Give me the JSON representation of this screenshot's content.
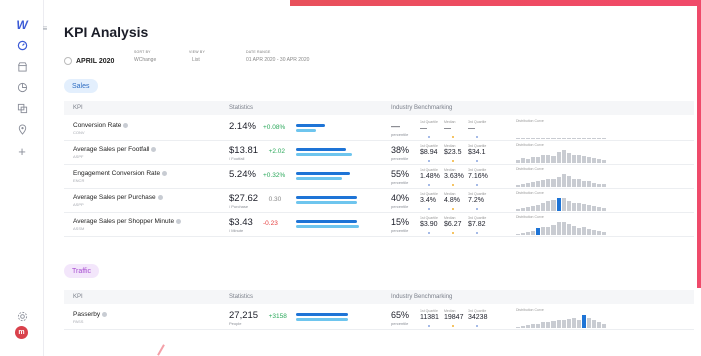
{
  "page": {
    "title": "KPI Analysis",
    "date_button": "APRIL 2020",
    "filters": [
      {
        "label": "SORT BY",
        "value": "WChange"
      },
      {
        "label": "VIEW BY",
        "value": "List"
      },
      {
        "label": "DATE RANGE",
        "value": "01 APR 2020 - 30 APR 2020"
      }
    ]
  },
  "colors": {
    "accent_blue": "#1e74d6",
    "light_blue": "#6ec5ee",
    "positive": "#2aa85a",
    "negative": "#e53e3e",
    "brand_pink": "#ef4a6a"
  },
  "icons": {
    "sidebar": [
      "logo-icon",
      "dashboard-icon",
      "store-icon",
      "chart-icon",
      "layers-icon",
      "location-icon",
      "add-icon"
    ],
    "settings": "settings-icon",
    "avatar": "m"
  },
  "table_headers": {
    "kpi": "KPI",
    "statistics": "Statistics",
    "benchmark": "Industry Benchmarking"
  },
  "sections": [
    {
      "label": "Sales",
      "rows": [
        {
          "name": "Conversion Rate",
          "code": "CONV",
          "value": "2.14%",
          "value_sub": "",
          "delta": "+0.08%",
          "delta_kind": "pos",
          "bar1": 0.45,
          "bar2": 0.32,
          "pct": "—",
          "pct_sub": "percentile",
          "q": [
            {
              "l": "1st Quartile",
              "v": "—"
            },
            {
              "l": "Median",
              "v": "—"
            },
            {
              "l": "3rd Quartile",
              "v": "—"
            }
          ],
          "dist_label": "Distribution Curve",
          "dist": [
            0.1,
            0.1,
            0.1,
            0.1,
            0.1,
            0.1,
            0.1,
            0.1,
            0.1,
            0.1,
            0.1,
            0.1,
            0.1,
            0.1,
            0.1,
            0.1,
            0.1,
            0.1
          ],
          "dist_hl": -1
        },
        {
          "name": "Average Sales per Footfall",
          "code": "ASPF",
          "value": "$13.81",
          "value_sub": "/ Footfall",
          "delta": "+2.02",
          "delta_kind": "pos",
          "bar1": 0.78,
          "bar2": 0.88,
          "pct": "38%",
          "pct_sub": "percentile",
          "q": [
            {
              "l": "1st Quartile",
              "v": "$8.94"
            },
            {
              "l": "Median",
              "v": "$23.5"
            },
            {
              "l": "3rd Quartile",
              "v": "$34.1"
            }
          ],
          "dist_label": "Distribution Curve",
          "dist": [
            0.2,
            0.35,
            0.3,
            0.45,
            0.4,
            0.55,
            0.6,
            0.5,
            0.8,
            0.9,
            0.7,
            0.55,
            0.6,
            0.5,
            0.45,
            0.35,
            0.3,
            0.25
          ],
          "dist_hl": -1
        },
        {
          "name": "Engagement Conversion Rate",
          "code": "ENCR",
          "value": "5.24%",
          "value_sub": "",
          "delta": "+0.32%",
          "delta_kind": "pos",
          "bar1": 0.85,
          "bar2": 0.72,
          "pct": "55%",
          "pct_sub": "percentile",
          "q": [
            {
              "l": "1st Quartile",
              "v": "1.48%"
            },
            {
              "l": "Median",
              "v": "3.63%"
            },
            {
              "l": "3rd Quartile",
              "v": "7.16%"
            }
          ],
          "dist_label": "Distribution Curve",
          "dist": [
            0.15,
            0.25,
            0.3,
            0.35,
            0.45,
            0.5,
            0.55,
            0.6,
            0.7,
            0.9,
            0.8,
            0.6,
            0.55,
            0.45,
            0.4,
            0.3,
            0.25,
            0.2
          ],
          "dist_hl": -1
        },
        {
          "name": "Average Sales per Purchase",
          "code": "ASPP",
          "value": "$27.62",
          "value_sub": "/ Purchase",
          "delta": "0.30",
          "delta_kind": "neu",
          "bar1": 0.95,
          "bar2": 0.95,
          "pct": "40%",
          "pct_sub": "percentile",
          "q": [
            {
              "l": "1st Quartile",
              "v": "3.4%"
            },
            {
              "l": "Median",
              "v": "4.8%"
            },
            {
              "l": "3rd Quartile",
              "v": "7.2%"
            }
          ],
          "dist_label": "Distribution Curve",
          "dist": [
            0.15,
            0.2,
            0.3,
            0.35,
            0.4,
            0.6,
            0.7,
            0.8,
            0.95,
            0.9,
            0.75,
            0.6,
            0.55,
            0.5,
            0.4,
            0.35,
            0.3,
            0.25
          ],
          "dist_hl": 8
        },
        {
          "name": "Average Sales per Shopper Minute",
          "code": "ASSM",
          "value": "$3.43",
          "value_sub": "/ Minute",
          "delta": "-0.23",
          "delta_kind": "neg",
          "bar1": 0.95,
          "bar2": 0.98,
          "pct": "15%",
          "pct_sub": "percentile",
          "q": [
            {
              "l": "1st Quartile",
              "v": "$3.90"
            },
            {
              "l": "Median",
              "v": "$6.27"
            },
            {
              "l": "3rd Quartile",
              "v": "$7.82"
            }
          ],
          "dist_label": "Distribution Curve",
          "dist": [
            0.1,
            0.15,
            0.2,
            0.3,
            0.5,
            0.6,
            0.55,
            0.7,
            0.9,
            0.95,
            0.8,
            0.65,
            0.5,
            0.55,
            0.45,
            0.35,
            0.3,
            0.2
          ],
          "dist_hl": 4
        }
      ]
    },
    {
      "label": "Traffic",
      "rows": [
        {
          "name": "Passerby",
          "code": "PASS",
          "value": "27,215",
          "value_sub": "People",
          "delta": "+3158",
          "delta_kind": "pos",
          "bar1": 0.82,
          "bar2": 0.82,
          "pct": "65%",
          "pct_sub": "percentile",
          "q": [
            {
              "l": "1st Quartile",
              "v": "11381"
            },
            {
              "l": "Median",
              "v": "19847"
            },
            {
              "l": "3rd Quartile",
              "v": "34238"
            }
          ],
          "dist_label": "Distribution Curve",
          "dist": [
            0.1,
            0.15,
            0.2,
            0.3,
            0.3,
            0.4,
            0.45,
            0.5,
            0.55,
            0.6,
            0.65,
            0.7,
            0.6,
            0.9,
            0.75,
            0.55,
            0.45,
            0.3
          ],
          "dist_hl": 13
        }
      ]
    }
  ]
}
